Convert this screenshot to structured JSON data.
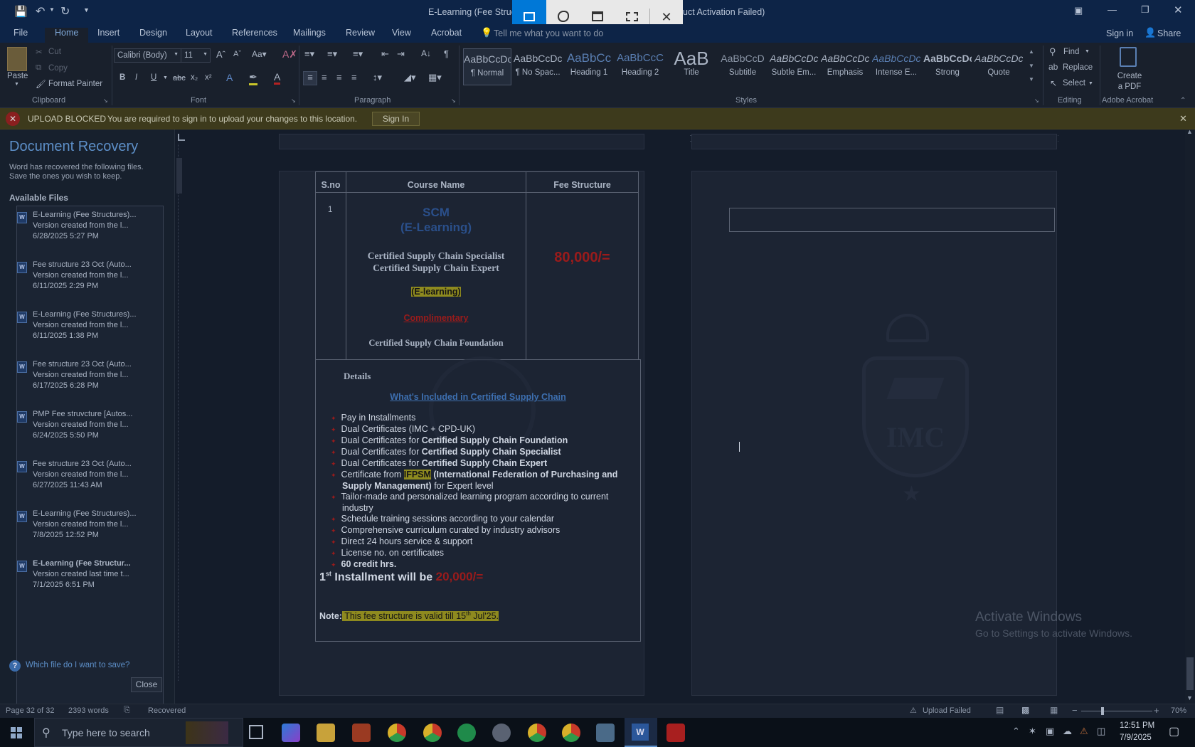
{
  "window": {
    "title_left": "E-Learning (Fee Struct",
    "title_right": "uct Activation Failed)"
  },
  "snip_toolbar": {
    "items": [
      "rectangle-snip",
      "freeform-snip",
      "window-snip",
      "fullscreen-snip",
      "close"
    ]
  },
  "ribbon": {
    "tabs": [
      "File",
      "Home",
      "Insert",
      "Design",
      "Layout",
      "References",
      "Mailings",
      "Review",
      "View",
      "Acrobat"
    ],
    "tell_me": "Tell me what you want to do",
    "sign_in": "Sign in",
    "share": "Share",
    "clipboard": {
      "paste": "Paste",
      "cut": "Cut",
      "copy": "Copy",
      "format_painter": "Format Painter",
      "label": "Clipboard"
    },
    "font": {
      "name": "Calibri (Body)",
      "size": "11",
      "label": "Font"
    },
    "paragraph": {
      "label": "Paragraph"
    },
    "styles": {
      "label": "Styles",
      "items": [
        {
          "sample": "AaBbCcDc",
          "name": "¶ Normal"
        },
        {
          "sample": "AaBbCcDc",
          "name": "¶ No Spac..."
        },
        {
          "sample": "AaBbCc",
          "name": "Heading 1"
        },
        {
          "sample": "AaBbCcC",
          "name": "Heading 2"
        },
        {
          "sample": "AaB",
          "name": "Title"
        },
        {
          "sample": "AaBbCcD",
          "name": "Subtitle"
        },
        {
          "sample": "AaBbCcDc",
          "name": "Subtle Em..."
        },
        {
          "sample": "AaBbCcDc",
          "name": "Emphasis"
        },
        {
          "sample": "AaBbCcDc",
          "name": "Intense E..."
        },
        {
          "sample": "AaBbCcDc",
          "name": "Strong"
        },
        {
          "sample": "AaBbCcDc",
          "name": "Quote"
        }
      ]
    },
    "editing": {
      "find": "Find",
      "replace": "Replace",
      "select": "Select",
      "label": "Editing"
    },
    "acrobat": {
      "create_pdf": "Create a PDF",
      "label": "Adobe Acrobat"
    }
  },
  "infobar": {
    "title": "UPLOAD BLOCKED",
    "message": "You are required to sign in to upload your changes to this location.",
    "button": "Sign In"
  },
  "recovery": {
    "heading": "Document Recovery",
    "description": "Word has recovered the following files. Save the ones you wish to keep.",
    "available": "Available Files",
    "files": [
      {
        "name": "E-Learning (Fee Structures)...",
        "desc": "Version created from the l...",
        "date": "6/28/2025 5:27 PM"
      },
      {
        "name": "Fee structure 23 Oct (Auto...",
        "desc": "Version created from the l...",
        "date": "6/11/2025 2:29 PM"
      },
      {
        "name": "E-Learning (Fee Structures)...",
        "desc": "Version created from the l...",
        "date": "6/11/2025 1:38 PM"
      },
      {
        "name": "Fee structure 23 Oct (Auto...",
        "desc": "Version created from the l...",
        "date": "6/17/2025 6:28 PM"
      },
      {
        "name": "PMP Fee struvcture  [Autos...",
        "desc": "Version created from the l...",
        "date": "6/24/2025 5:50 PM"
      },
      {
        "name": "Fee structure 23 Oct (Auto...",
        "desc": "Version created from the l...",
        "date": "6/27/2025 11:43 AM"
      },
      {
        "name": "E-Learning (Fee Structures)...",
        "desc": "Version created from the l...",
        "date": "7/8/2025 12:52 PM"
      },
      {
        "name": "E-Learning (Fee Structur...",
        "desc": "Version created last time t...",
        "date": "7/1/2025 6:51 PM"
      }
    ],
    "help_link": "Which file do I want to save?",
    "close": "Close"
  },
  "document": {
    "headers": [
      "S.no",
      "Course Name",
      "Fee Structure"
    ],
    "row_no": "1",
    "course_title": "SCM",
    "course_sub": "(E-Learning)",
    "cert1": "Certified Supply Chain Specialist",
    "cert2": "Certified Supply Chain Expert",
    "elearning": "(E-learning)",
    "complimentary": "Complimentary",
    "foundation": "Certified Supply Chain Foundation",
    "fee": "80,000/=",
    "details": "Details",
    "included": "What's Included in Certified Supply Chain",
    "bullets": [
      [
        "Pay in Installments",
        ""
      ],
      [
        "Dual Certificates (IMC + CPD-UK)",
        ""
      ],
      [
        "Dual Certificates for ",
        "Certified Supply Chain Foundation"
      ],
      [
        "Dual Certificates for ",
        "Certified Supply Chain Specialist"
      ],
      [
        "Dual Certificates for ",
        "Certified Supply Chain Expert"
      ]
    ],
    "ifpsm_pre": "Certificate from ",
    "ifpsm": "IFPSM",
    "ifpsm_full": " (International Federation of Purchasing and Supply Management)",
    "ifpsm_post": " for Expert level",
    "bullets2": [
      "Tailor-made and personalized learning program according to current industry",
      "Schedule training sessions according to your calendar",
      "Comprehensive curriculum curated by industry advisors",
      "Direct 24 hours service & support",
      "License no. on certificates"
    ],
    "credit": "60 credit hrs.",
    "installment_pre": "1",
    "installment_sup": "st",
    "installment_mid": " Installment will be ",
    "installment_amt": "20,000/=",
    "note_label": "Note:",
    "note_text": " This fee structure is valid till 15",
    "note_sup": "th",
    "note_end": " Jul'25.",
    "watermark": "IMC"
  },
  "activate": {
    "line1": "Activate Windows",
    "line2": "Go to Settings to activate Windows."
  },
  "status": {
    "page": "Page 32 of 32",
    "words": "2393 words",
    "recovered": "Recovered",
    "upload": "Upload Failed",
    "zoom": "70%"
  },
  "taskbar": {
    "search": "Type here to search",
    "time": "12:51 PM",
    "date": "7/9/2025"
  },
  "colors": {
    "accent": "#0078d7",
    "dark_red": "#9a1b1b",
    "highlight": "#8e8a1f"
  }
}
